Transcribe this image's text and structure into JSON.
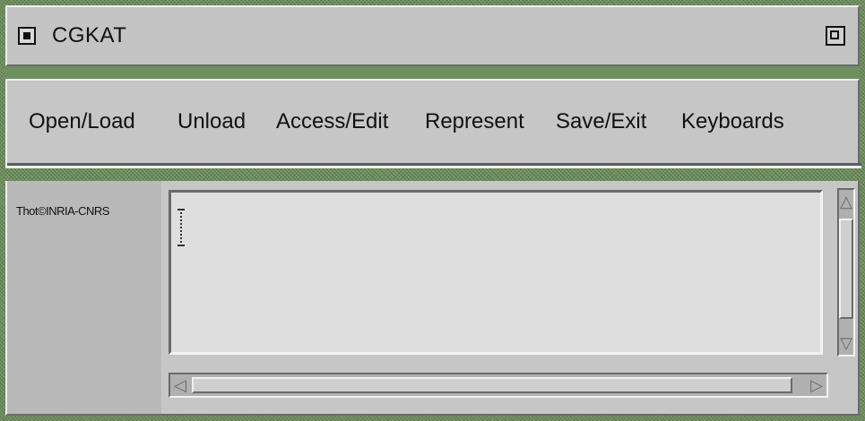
{
  "window": {
    "title": "CGKAT"
  },
  "menubar": {
    "items": [
      {
        "label": "Open/Load"
      },
      {
        "label": "Unload"
      },
      {
        "label": "Access/Edit"
      },
      {
        "label": "Represent"
      },
      {
        "label": "Save/Exit"
      },
      {
        "label": "Keyboards"
      }
    ]
  },
  "sidebar": {
    "credit": "Thot©INRIA-CNRS"
  },
  "icons": {
    "window_menu": "window-menu-icon",
    "maximize": "maximize-icon",
    "scroll_up": "arrow-up-icon",
    "scroll_down": "arrow-down-icon",
    "scroll_left": "arrow-left-icon",
    "scroll_right": "arrow-right-icon",
    "text_cursor": "text-cursor-icon"
  },
  "colors": {
    "panel": "#c6c6c6",
    "desktop": "#6f8f5f",
    "document": "#dedede"
  }
}
